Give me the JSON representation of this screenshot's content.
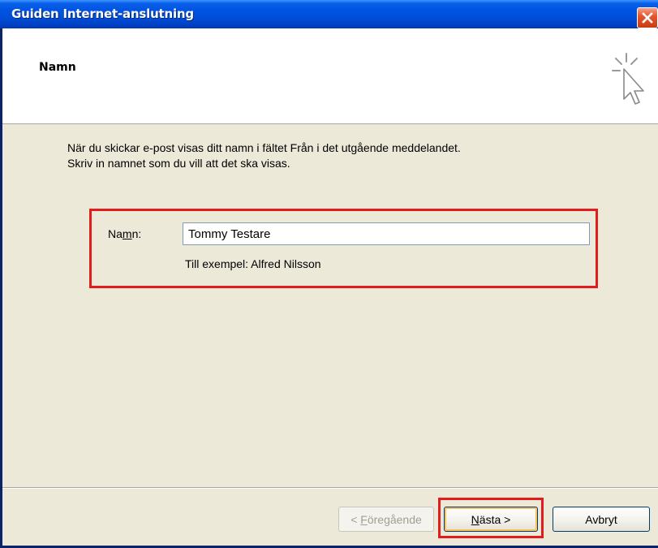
{
  "window": {
    "title": "Guiden Internet-anslutning"
  },
  "header": {
    "title": "Namn",
    "icon": "wizard-cursor-icon"
  },
  "description": {
    "line1": "När du skickar e-post visas ditt namn i fältet Från i det utgående meddelandet.",
    "line2": "Skriv in namnet som du vill att det ska visas."
  },
  "form": {
    "name_label_pre": "Na",
    "name_label_accel": "m",
    "name_label_post": "n:",
    "name_value": "Tommy Testare",
    "example": "Till exempel: Alfred Nilsson"
  },
  "buttons": {
    "back_pre": "< ",
    "back_accel": "F",
    "back_post": "öregående",
    "next_accel": "N",
    "next_post": "ästa >",
    "cancel": "Avbryt"
  },
  "colors": {
    "highlight": "#e21b1b",
    "titlebar": "#0054e3",
    "dialog_bg": "#ece9d8"
  }
}
